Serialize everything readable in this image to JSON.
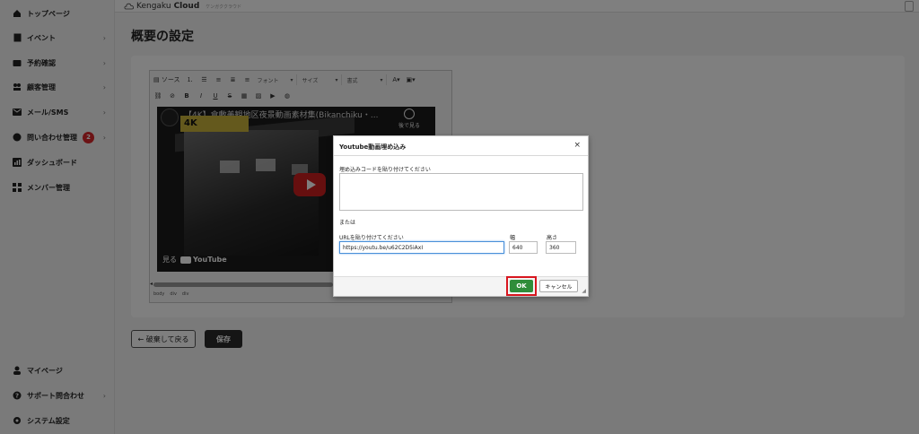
{
  "sidebar": {
    "items": [
      {
        "label": "トップページ",
        "icon": "home-icon",
        "chevron": ""
      },
      {
        "label": "イベント",
        "icon": "document-icon",
        "chevron": "›"
      },
      {
        "label": "予約確認",
        "icon": "wallet-icon",
        "chevron": "›"
      },
      {
        "label": "顧客管理",
        "icon": "users-icon",
        "chevron": "›"
      },
      {
        "label": "メール/SMS",
        "icon": "mail-icon",
        "chevron": "›"
      },
      {
        "label": "問い合わせ管理",
        "icon": "chat-icon",
        "chevron": "›",
        "badge": "2"
      },
      {
        "label": "ダッシュボード",
        "icon": "chart-icon",
        "chevron": ""
      },
      {
        "label": "メンバー管理",
        "icon": "grid-icon",
        "chevron": ""
      }
    ],
    "bottom_items": [
      {
        "label": "マイページ",
        "icon": "person-icon",
        "chevron": ""
      },
      {
        "label": "サポート問合わせ",
        "icon": "help-icon",
        "chevron": "›"
      },
      {
        "label": "システム設定",
        "icon": "gear-icon",
        "chevron": ""
      }
    ]
  },
  "topbar": {
    "logo_text": "Kengaku",
    "logo_bold": "Cloud",
    "logo_sub": "ケンガククラウド"
  },
  "page": {
    "title": "概要の設定",
    "back_button": "← 破棄して戻る",
    "save_button": "保存"
  },
  "editor": {
    "toolbar_row1": {
      "source": "ソース",
      "font": "フォント",
      "size": "サイズ",
      "format": "書式"
    },
    "video": {
      "title": "【4K】倉敷美観地区夜景動画素材集(Bikanchiku・...",
      "badge": "4K",
      "watch_later": "後で見る",
      "watch_on": "見る",
      "youtube": "YouTube"
    },
    "path": [
      "body",
      "div",
      "div"
    ]
  },
  "dialog": {
    "title": "Youtube動画埋め込み",
    "close": "×",
    "embed_label": "埋め込みコードを貼り付けてください",
    "or_label": "または",
    "url_label": "URLを貼り付けてください",
    "url_value": "https://youtu.be/u62C2D5iAxI",
    "width_label": "幅",
    "width_value": "640",
    "height_label": "高さ",
    "height_value": "360",
    "ok": "OK",
    "cancel": "キャンセル"
  },
  "colors": {
    "ok_green": "#2f8d3a",
    "highlight_red": "#d8161f",
    "badge_red": "#d9262a",
    "save_dark": "#2b2b2b"
  }
}
